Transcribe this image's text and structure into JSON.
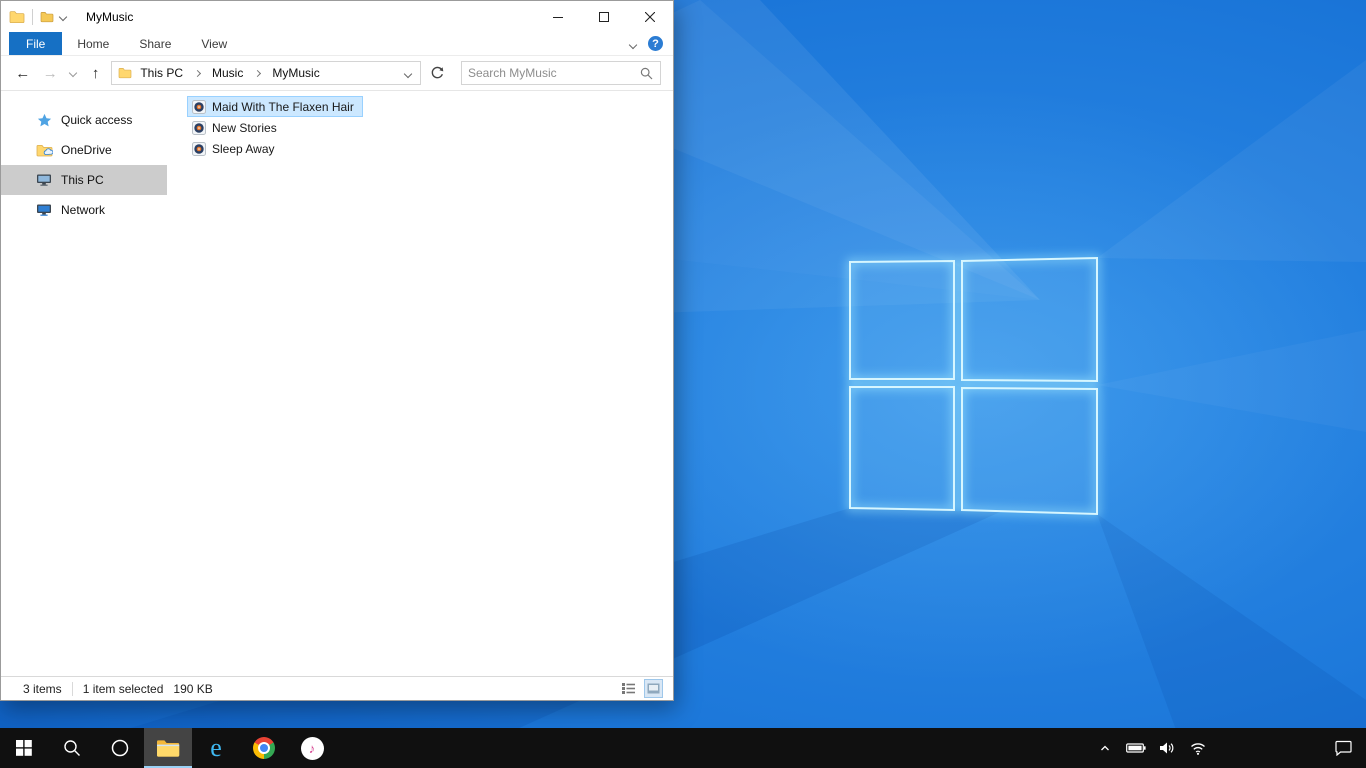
{
  "colors": {
    "accent_blue": "#1670c4",
    "selection_fill": "#cce8ff",
    "selection_border": "#99d1ff",
    "sidebar_selected": "#cccccc",
    "taskbar_background": "#101010",
    "wallpaper_base": "#1573d6"
  },
  "window": {
    "title": "MyMusic"
  },
  "ribbon": {
    "tabs": [
      {
        "label": "File",
        "active": true
      },
      {
        "label": "Home",
        "active": false
      },
      {
        "label": "Share",
        "active": false
      },
      {
        "label": "View",
        "active": false
      }
    ],
    "help_label": "?"
  },
  "navigation": {
    "breadcrumb": [
      "This PC",
      "Music",
      "MyMusic"
    ],
    "search": {
      "placeholder": "Search MyMusic",
      "value": ""
    }
  },
  "sidebar": {
    "items": [
      {
        "label": "Quick access",
        "icon": "quick-access-star",
        "selected": false
      },
      {
        "label": "OneDrive",
        "icon": "onedrive",
        "selected": false
      },
      {
        "label": "This PC",
        "icon": "this-pc",
        "selected": true
      },
      {
        "label": "Network",
        "icon": "network",
        "selected": false
      }
    ]
  },
  "files": [
    {
      "name": "Maid With The Flaxen Hair",
      "icon": "music-file",
      "selected": true
    },
    {
      "name": "New Stories",
      "icon": "music-file",
      "selected": false
    },
    {
      "name": "Sleep Away",
      "icon": "music-file",
      "selected": false
    }
  ],
  "statusbar": {
    "item_count": "3 items",
    "selection": "1 item selected",
    "selection_size": "190 KB"
  },
  "taskbar": {
    "buttons": [
      "start",
      "search",
      "cortana",
      "file-explorer",
      "internet-explorer",
      "chrome",
      "itunes"
    ],
    "active_button": "file-explorer",
    "tray": [
      "hidden-icons-chevron",
      "battery",
      "volume",
      "network",
      "action-center"
    ]
  }
}
